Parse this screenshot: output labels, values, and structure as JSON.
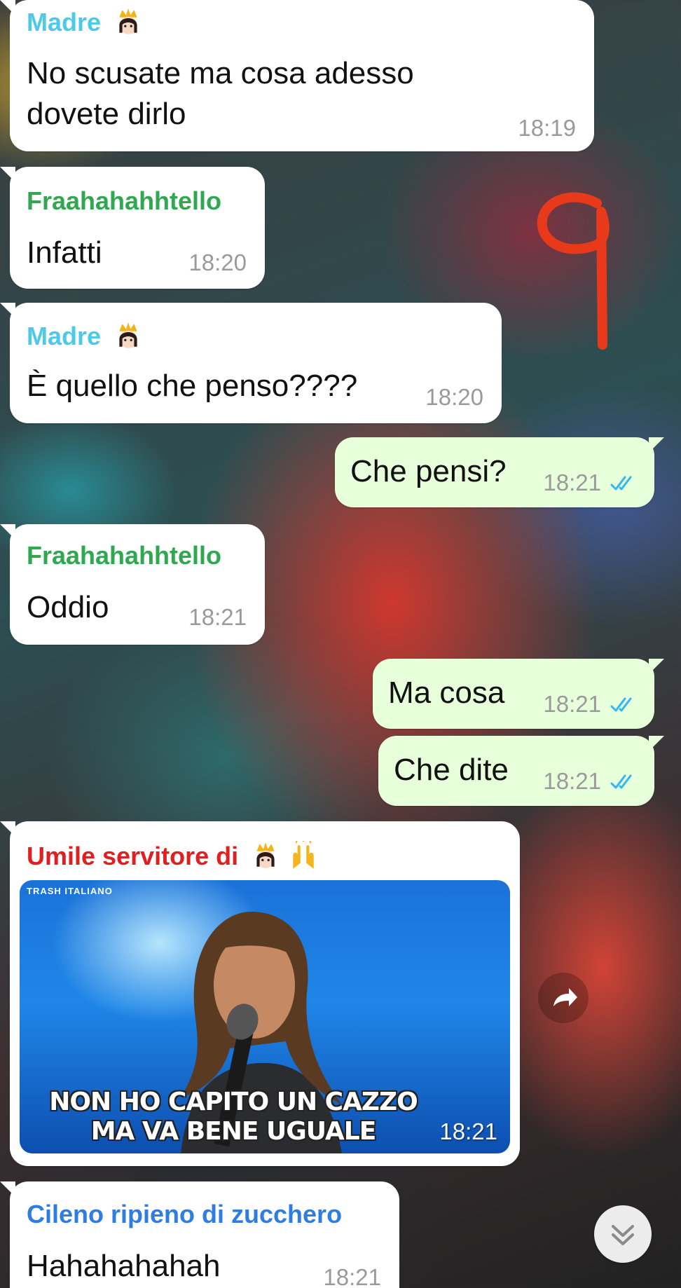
{
  "colors": {
    "sender_madre": "#4ccbe6",
    "sender_fraaha": "#2fa84f",
    "sender_umile": "#e02020",
    "sender_cileno": "#2f7de0",
    "incoming_bubble": "#ffffff",
    "outgoing_bubble": "#e7ffdb",
    "read_ticks": "#34b7f1",
    "timestamp": "#9a9a9a"
  },
  "messages": [
    {
      "direction": "in",
      "sender": "Madre",
      "sender_emoji": "princess-emoji",
      "text": [
        "No scusate ma cosa adesso",
        "dovete dirlo"
      ],
      "time": "18:19"
    },
    {
      "direction": "in",
      "sender": "Fraahahahhtello",
      "text": [
        "Infatti"
      ],
      "time": "18:20"
    },
    {
      "direction": "in",
      "sender": "Madre",
      "sender_emoji": "princess-emoji",
      "text": [
        "È quello che penso????"
      ],
      "time": "18:20"
    },
    {
      "direction": "out",
      "text": [
        "Che pensi?"
      ],
      "time": "18:21",
      "status": "read"
    },
    {
      "direction": "in",
      "sender": "Fraahahahhtello",
      "text": [
        "Oddio"
      ],
      "time": "18:21"
    },
    {
      "direction": "out",
      "text": [
        "Ma cosa"
      ],
      "time": "18:21",
      "status": "read"
    },
    {
      "direction": "out",
      "text": [
        "Che dite"
      ],
      "time": "18:21",
      "status": "read"
    },
    {
      "direction": "in",
      "sender": "Umile servitore di",
      "sender_emojis": [
        "princess-emoji",
        "raising-hands-emoji"
      ],
      "media": {
        "type": "gif",
        "corner_label": "TRASH ITALIANO",
        "caption": [
          "NON HO CAPITO UN CAZZO",
          "MA VA BENE UGUALE"
        ]
      },
      "time": "18:21"
    },
    {
      "direction": "in",
      "sender": "Cileno ripieno di zucchero",
      "text": [
        "Hahahahahah"
      ],
      "time": "18:21"
    }
  ],
  "controls": {
    "forward_icon": "forward-arrow-icon",
    "scroll_down_icon": "double-chevron-down-icon"
  }
}
